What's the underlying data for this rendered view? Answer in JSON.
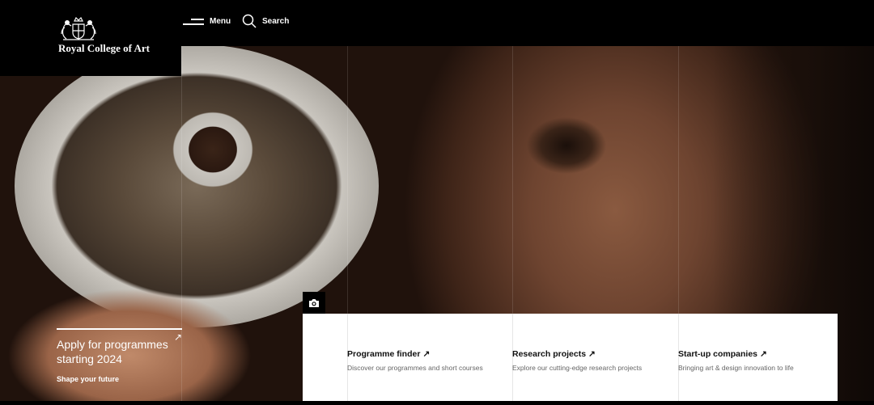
{
  "header": {
    "logo_text": "Royal College of Art",
    "menu_label": "Menu",
    "search_label": "Search"
  },
  "hero": {
    "apply_title": "Apply for programmes starting 2024",
    "apply_subtitle": "Shape your future",
    "apply_arrow": "↗"
  },
  "cards": [
    {
      "title": "Programme finder",
      "arrow": "↗",
      "description": "Discover our programmes and short courses"
    },
    {
      "title": "Research projects",
      "arrow": "↗",
      "description": "Explore our cutting-edge research projects"
    },
    {
      "title": "Start-up companies",
      "arrow": "↗",
      "description": "Bringing art & design innovation to life"
    }
  ],
  "icons": [
    "crest-logo-icon",
    "menu-icon",
    "search-icon",
    "camera-icon",
    "arrow-up-right-icon"
  ],
  "colors": {
    "background": "#000000",
    "panel": "#ffffff",
    "text_dark": "#111111",
    "text_muted": "#666666"
  }
}
